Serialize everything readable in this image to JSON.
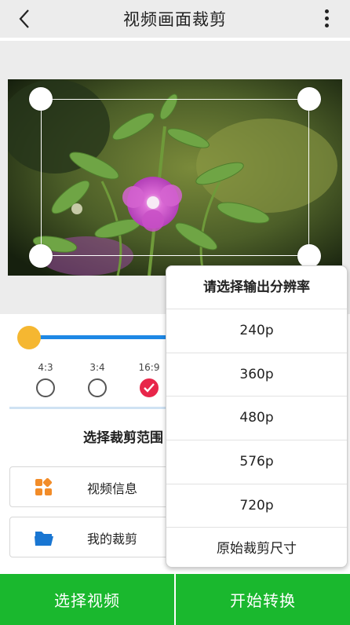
{
  "titlebar": {
    "title": "视频画面裁剪"
  },
  "aspect_ratios": [
    {
      "label": "4:3",
      "selected": false
    },
    {
      "label": "3:4",
      "selected": false
    },
    {
      "label": "16:9",
      "selected": true
    }
  ],
  "crop_range_label": "选择裁剪范围",
  "cards": [
    {
      "label": "视频信息",
      "icon": "grid-apps-icon"
    },
    {
      "label": "我的裁剪",
      "icon": "folder-icon"
    }
  ],
  "buttons": {
    "select_video": "选择视频",
    "start_convert": "开始转换"
  },
  "resolution_popup": {
    "title": "请选择输出分辨率",
    "options": [
      "240p",
      "360p",
      "480p",
      "576p",
      "720p",
      "原始裁剪尺寸"
    ]
  },
  "colors": {
    "accent_green": "#1ab82e",
    "slider_blue": "#1e88e5",
    "slider_knob": "#f5b731",
    "selected_red": "#e8264a",
    "icon_orange": "#f28c28",
    "icon_blue": "#1976d2"
  }
}
